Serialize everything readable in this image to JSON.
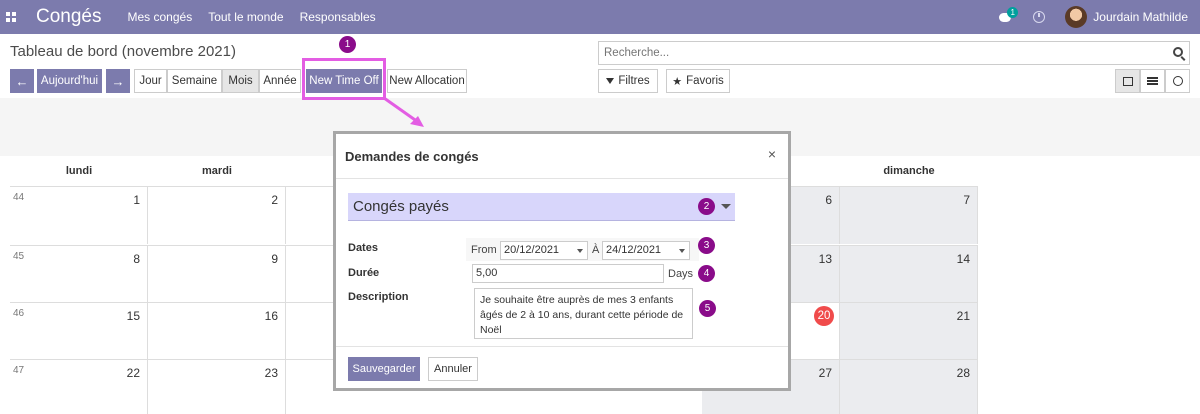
{
  "navbar": {
    "brand": "Congés",
    "menu": [
      "Mes congés",
      "Tout le monde",
      "Responsables"
    ],
    "chat_count": "1",
    "user_name": "Jourdain Mathilde"
  },
  "control": {
    "title": "Tableau de bord (novembre 2021)",
    "today": "Aujourd'hui",
    "ranges": [
      "Jour",
      "Semaine",
      "Mois",
      "Année"
    ],
    "active_range": "Mois",
    "new_time_off": "New Time Off",
    "new_allocation": "New Allocation",
    "search_placeholder": "Recherche...",
    "filters": "Filtres",
    "favorites": "Favoris"
  },
  "calendar": {
    "headers": {
      "mon": "lundi",
      "tue": "mardi",
      "sun": "dimanche"
    },
    "weeks": [
      {
        "num": "44",
        "mon": "1",
        "tue": "2",
        "sat": "6",
        "sun": "7"
      },
      {
        "num": "45",
        "mon": "8",
        "tue": "9",
        "sat": "13",
        "sun": "14"
      },
      {
        "num": "46",
        "mon": "15",
        "tue": "16",
        "sat": "20",
        "sun": "21"
      },
      {
        "num": "47",
        "mon": "22",
        "tue": "23",
        "sat": "27",
        "sun": "28"
      }
    ],
    "today": "20"
  },
  "modal": {
    "title": "Demandes de congés",
    "close": "×",
    "type_value": "Congés payés",
    "dates_label": "Dates",
    "from_label": "From",
    "from_value": "20/12/2021",
    "to_label": "À",
    "to_value": "24/12/2021",
    "duration_label": "Durée",
    "duration_value": "5,00",
    "duration_unit": "Days",
    "description_label": "Description",
    "description_value": "Je souhaite être auprès de mes 3 enfants âgés de 2 à 10 ans, durant cette période de Noël",
    "save": "Sauvegarder",
    "cancel": "Annuler"
  },
  "steps": [
    "1",
    "2",
    "3",
    "4",
    "5"
  ],
  "colors": {
    "brand": "#7c7bad",
    "highlight": "#e35de3",
    "step_badge": "#8a0c8a",
    "today": "#f04b4b"
  }
}
